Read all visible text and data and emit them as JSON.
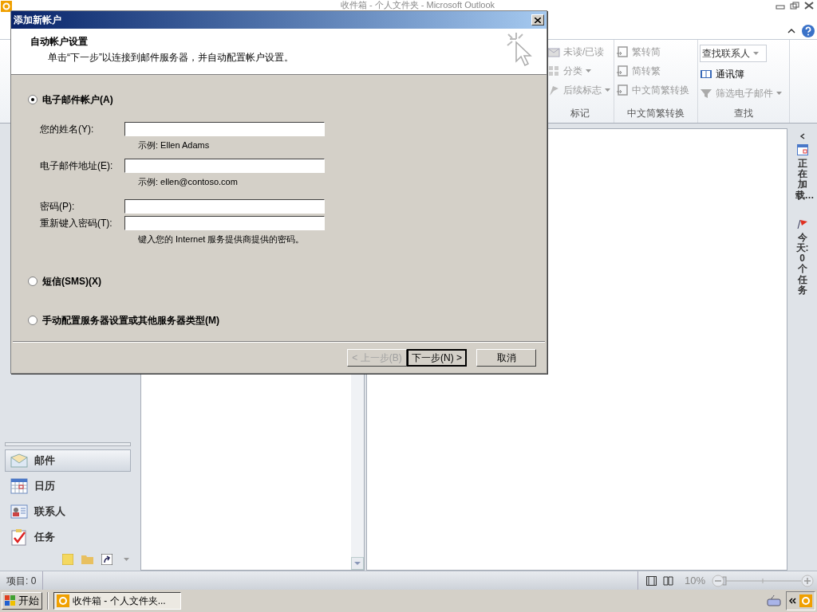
{
  "window": {
    "title": "收件箱 - 个人文件夹 - Microsoft Outlook"
  },
  "ribbon": {
    "groups": [
      {
        "label": "标记",
        "items": [
          {
            "kind": "button",
            "label": "未读/已读",
            "dropdown": false,
            "disabled": true
          },
          {
            "kind": "button",
            "label": "分类",
            "dropdown": true,
            "disabled": true
          },
          {
            "kind": "button",
            "label": "后续标志",
            "dropdown": true,
            "disabled": true
          }
        ]
      },
      {
        "label": "中文简繁转换",
        "items": [
          {
            "kind": "button",
            "label": "繁转简",
            "dropdown": false,
            "disabled": true
          },
          {
            "kind": "button",
            "label": "简转繁",
            "dropdown": false,
            "disabled": true
          },
          {
            "kind": "button",
            "label": "中文简繁转换",
            "dropdown": false,
            "disabled": true
          }
        ]
      },
      {
        "label": "查找",
        "items": [
          {
            "kind": "field",
            "label": "查找联系人",
            "dropdown": true,
            "disabled": false
          },
          {
            "kind": "button",
            "label": "通讯簿",
            "dropdown": false,
            "disabled": false
          },
          {
            "kind": "button",
            "label": "筛选电子邮件",
            "dropdown": true,
            "disabled": true
          }
        ]
      }
    ]
  },
  "navigation": {
    "items": [
      {
        "kind": "mail",
        "label": "邮件",
        "selected": true
      },
      {
        "kind": "calendar",
        "label": "日历",
        "selected": false
      },
      {
        "kind": "contacts",
        "label": "联系人",
        "selected": false
      },
      {
        "kind": "tasks",
        "label": "任务",
        "selected": false
      }
    ]
  },
  "todo_bar": {
    "items": [
      {
        "kind": "calendar",
        "label": "正在加载…"
      },
      {
        "kind": "flag",
        "label": "今天:0 个任务"
      }
    ]
  },
  "status_bar": {
    "items_count": "项目: 0",
    "zoom": "10%",
    "zoom_slider": {
      "level": 0
    }
  },
  "taskbar": {
    "start": "开始",
    "tasks": [
      {
        "label": "收件箱 - 个人文件夹...",
        "selected": true
      }
    ]
  },
  "dialog": {
    "title": "添加新帐户",
    "heading": "自动帐户设置",
    "subtitle": "单击“下一步”以连接到邮件服务器，并自动配置帐户设置。",
    "account_types": [
      {
        "label": "电子邮件帐户(A)",
        "selected": true
      },
      {
        "label": "短信(SMS)(X)",
        "selected": false
      },
      {
        "label": "手动配置服务器设置或其他服务器类型(M)",
        "selected": false
      }
    ],
    "fields": [
      {
        "label": "您的姓名(Y):",
        "hint": "示例: Ellen Adams"
      },
      {
        "label": "电子邮件地址(E):",
        "hint": "示例: ellen@contoso.com"
      },
      {
        "label": "密码(P):"
      },
      {
        "label": "重新键入密码(T):",
        "hint": "键入您的 Internet 服务提供商提供的密码。"
      }
    ],
    "buttons": [
      {
        "label": "< 上一步(B)",
        "disabled": true,
        "default": false
      },
      {
        "label": "下一步(N) >",
        "disabled": false,
        "default": true
      },
      {
        "label": "取消",
        "disabled": false,
        "default": false
      }
    ]
  }
}
